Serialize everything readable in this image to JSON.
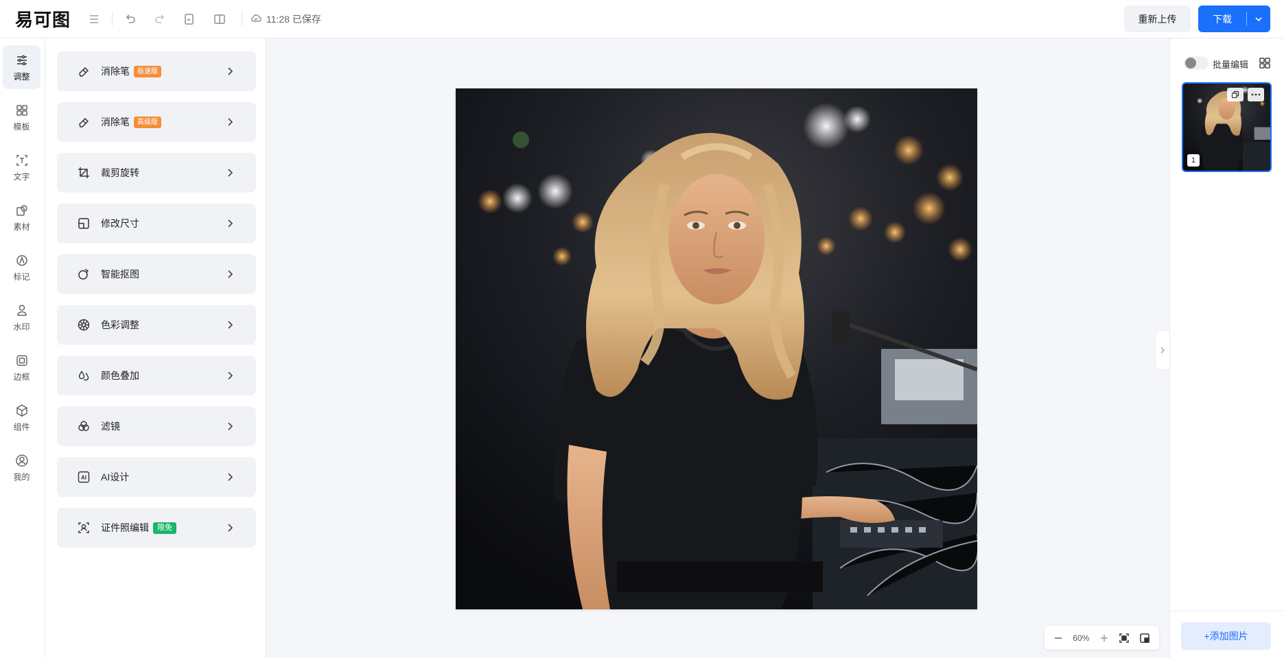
{
  "app": {
    "logo_text": "易可图"
  },
  "toolbar": {
    "menu_icon": "menu-icon",
    "undo_icon": "undo-icon",
    "redo_icon": "redo-icon",
    "history_icon": "history-icon",
    "compare_icon": "compare-icon",
    "saved_text": "11:28 已保存",
    "reupload_label": "重新上传",
    "download_label": "下载"
  },
  "nav": {
    "items": [
      {
        "label": "调整",
        "icon": "sliders-icon",
        "active": true
      },
      {
        "label": "模板",
        "icon": "template-icon"
      },
      {
        "label": "文字",
        "icon": "text-icon"
      },
      {
        "label": "素材",
        "icon": "material-icon"
      },
      {
        "label": "标记",
        "icon": "mark-icon"
      },
      {
        "label": "水印",
        "icon": "watermark-icon"
      },
      {
        "label": "边框",
        "icon": "border-icon"
      },
      {
        "label": "组件",
        "icon": "component-icon"
      },
      {
        "label": "我的",
        "icon": "user-icon"
      }
    ]
  },
  "tools": [
    {
      "label": "消除笔",
      "tag": "极速版",
      "tag_color": "#f58e3a",
      "icon": "eraser-icon"
    },
    {
      "label": "消除笔",
      "tag": "高级版",
      "tag_color": "#f58e3a",
      "icon": "eraser-icon"
    },
    {
      "label": "裁剪旋转",
      "tag": "",
      "icon": "crop-icon"
    },
    {
      "label": "修改尺寸",
      "tag": "",
      "icon": "resize-icon"
    },
    {
      "label": "智能抠图",
      "tag": "",
      "icon": "cutout-icon"
    },
    {
      "label": "色彩调整",
      "tag": "",
      "icon": "color-wheel-icon"
    },
    {
      "label": "颜色叠加",
      "tag": "",
      "icon": "drops-icon"
    },
    {
      "label": "滤镜",
      "tag": "",
      "icon": "filter-icon"
    },
    {
      "label": "AI设计",
      "tag": "",
      "icon": "ai-icon"
    },
    {
      "label": "证件照编辑",
      "tag": "限免",
      "tag_color": "#19b56a",
      "icon": "id-photo-icon"
    }
  ],
  "zoom": {
    "level": "60%"
  },
  "right_panel": {
    "batch_label": "批量编辑",
    "thumb_index": "1",
    "add_image_label": "+添加图片"
  },
  "colors": {
    "accent": "#1a6ffb",
    "tag_orange": "#f58e3a",
    "tag_green": "#19b56a"
  }
}
